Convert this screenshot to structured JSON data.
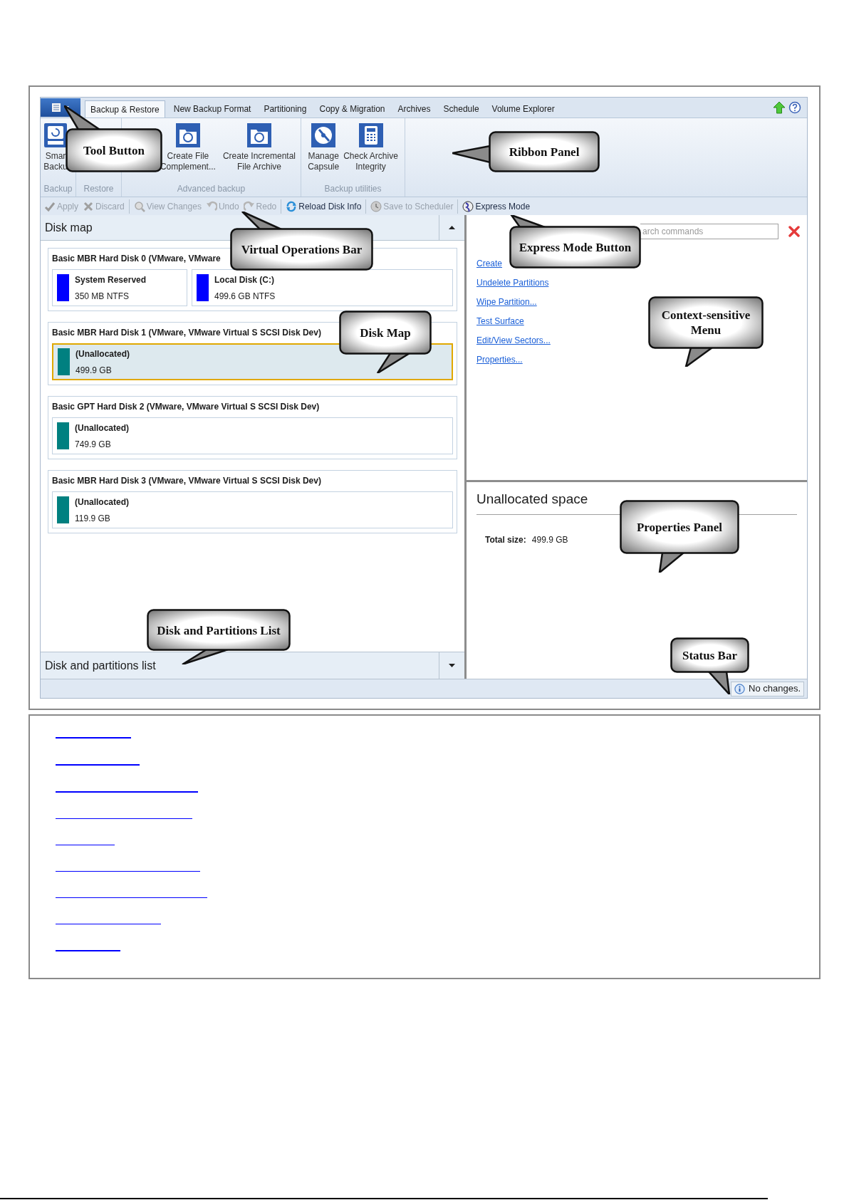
{
  "app_menu_button": {
    "kind": "menu"
  },
  "tabs": [
    {
      "label": "Backup & Restore",
      "selected": true
    },
    {
      "label": "New Backup Format",
      "selected": false
    },
    {
      "label": "Partitioning",
      "selected": false
    },
    {
      "label": "Copy & Migration",
      "selected": false
    },
    {
      "label": "Archives",
      "selected": false
    },
    {
      "label": "Schedule",
      "selected": false
    },
    {
      "label": "Volume Explorer",
      "selected": false
    }
  ],
  "ribbon_groups": [
    {
      "label": "Backup",
      "buttons": [
        {
          "lines": [
            "Smar",
            "Backu"
          ]
        }
      ]
    },
    {
      "label": "Restore"
    },
    {
      "label": "Advanced backup",
      "buttons": [
        {
          "lines": [
            "Create File",
            "Complement..."
          ]
        },
        {
          "lines": [
            "Create Incremental",
            "File Archive"
          ]
        }
      ]
    },
    {
      "label": "Backup utilities",
      "buttons": [
        {
          "lines": [
            "Manage",
            "Capsule"
          ]
        },
        {
          "lines": [
            "Check Archive",
            "Integrity"
          ]
        }
      ]
    }
  ],
  "toolbar": [
    {
      "label": "Apply",
      "disabled": true
    },
    {
      "label": "Discard",
      "disabled": true
    },
    {
      "label": "View Changes",
      "disabled": true
    },
    {
      "label": "Undo",
      "disabled": true
    },
    {
      "label": "Redo",
      "disabled": true
    },
    {
      "label": "Reload Disk Info",
      "disabled": false
    },
    {
      "label": "Save to Scheduler",
      "disabled": true
    },
    {
      "label": "Express Mode",
      "disabled": false
    }
  ],
  "disk_map": {
    "title": "Disk map",
    "disks": [
      {
        "title": "Basic MBR Hard Disk 0 (VMware, VMware",
        "partitions": [
          {
            "name": "System Reserved",
            "info": "350 MB NTFS",
            "color": "#0000ff",
            "selected": false
          },
          {
            "name": "Local Disk (C:)",
            "info": "499.6 GB NTFS",
            "color": "#0000ff",
            "selected": false
          }
        ]
      },
      {
        "title": "Basic MBR Hard Disk 1 (VMware, VMware Virtual S SCSI Disk Dev)",
        "partitions": [
          {
            "name": "(Unallocated)",
            "info": "499.9 GB",
            "color": "#008080",
            "selected": true
          }
        ]
      },
      {
        "title": "Basic GPT Hard Disk 2 (VMware, VMware Virtual S SCSI Disk Dev)",
        "partitions": [
          {
            "name": "(Unallocated)",
            "info": "749.9 GB",
            "color": "#008080",
            "selected": false
          }
        ]
      },
      {
        "title": "Basic MBR Hard Disk 3 (VMware, VMware Virtual S SCSI Disk Dev)",
        "partitions": [
          {
            "name": "(Unallocated)",
            "info": "119.9 GB",
            "color": "#008080",
            "selected": false
          }
        ]
      }
    ]
  },
  "disk_list_header": "Disk and partitions list",
  "search": {
    "placeholder": "arch commands"
  },
  "commands": [
    "Create",
    "Undelete Partitions",
    "Wipe Partition...",
    "Test Surface",
    "Edit/View Sectors...",
    "Properties..."
  ],
  "properties": {
    "title": "Unallocated space",
    "label": "Total size:",
    "value": "499.9 GB"
  },
  "status": "No changes.",
  "callouts": [
    {
      "text": "Tool Button"
    },
    {
      "text": "Ribbon Panel"
    },
    {
      "text": "Virtual Operations Bar"
    },
    {
      "text": "Express Mode Button"
    },
    {
      "text": "Disk Map"
    },
    {
      "text": "Context-sensitive Menu"
    },
    {
      "text": "Properties Panel"
    },
    {
      "text": "Disk and Partitions List"
    },
    {
      "text": "Status Bar"
    }
  ],
  "link_lines": [
    {
      "kind": "thick"
    },
    {
      "kind": "thick"
    },
    {
      "kind": "thick"
    },
    {
      "kind": "thin"
    },
    {
      "kind": "thin"
    },
    {
      "kind": "thin"
    },
    {
      "kind": "thin"
    },
    {
      "kind": "thin"
    },
    {
      "kind": "thick"
    }
  ]
}
